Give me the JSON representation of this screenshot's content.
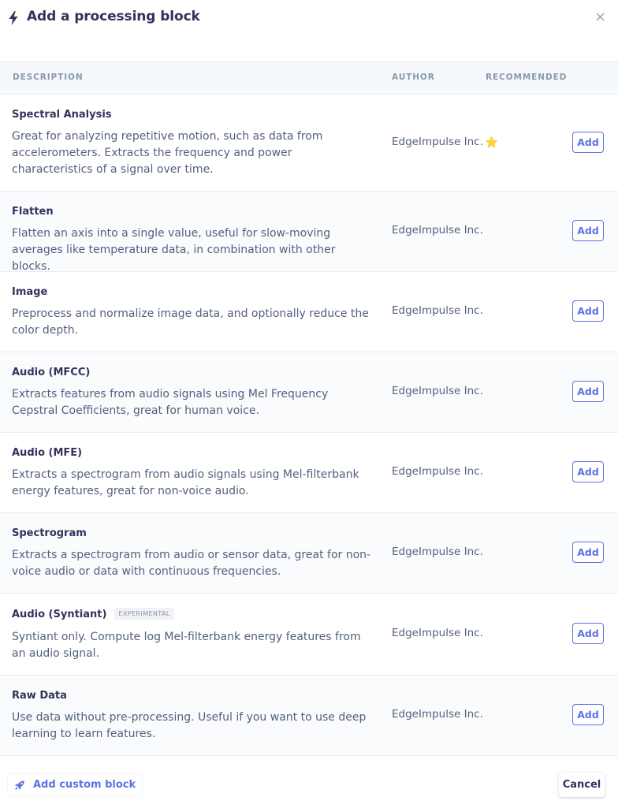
{
  "modal": {
    "title": "Add a processing block",
    "close_label": "×"
  },
  "table": {
    "headers": {
      "description": "DESCRIPTION",
      "author": "AUTHOR",
      "recommended": "RECOMMENDED"
    },
    "rows": [
      {
        "title": "Spectral Analysis",
        "description": "Great for analyzing repetitive motion, such as data from accelerometers. Extracts the frequency and power characteristics of a signal over time.",
        "author": "EdgeImpulse Inc.",
        "recommended": true,
        "add_label": "Add"
      },
      {
        "title": "Flatten",
        "description": "Flatten an axis into a single value, useful for slow-moving averages like temperature data, in combination with other blocks.",
        "author": "EdgeImpulse Inc.",
        "recommended": false,
        "add_label": "Add"
      },
      {
        "title": "Image",
        "description": "Preprocess and normalize image data, and optionally reduce the color depth.",
        "author": "EdgeImpulse Inc.",
        "recommended": false,
        "add_label": "Add"
      },
      {
        "title": "Audio (MFCC)",
        "description": "Extracts features from audio signals using Mel Frequency Cepstral Coefficients, great for human voice.",
        "author": "EdgeImpulse Inc.",
        "recommended": false,
        "add_label": "Add"
      },
      {
        "title": "Audio (MFE)",
        "description": "Extracts a spectrogram from audio signals using Mel-filterbank energy features, great for non-voice audio.",
        "author": "EdgeImpulse Inc.",
        "recommended": false,
        "add_label": "Add"
      },
      {
        "title": "Spectrogram",
        "description": "Extracts a spectrogram from audio or sensor data, great for non-voice audio or data with continuous frequencies.",
        "author": "EdgeImpulse Inc.",
        "recommended": false,
        "add_label": "Add"
      },
      {
        "title": "Audio (Syntiant)",
        "badge": "EXPERIMENTAL",
        "description": "Syntiant only. Compute log Mel-filterbank energy features from an audio signal.",
        "author": "EdgeImpulse Inc.",
        "recommended": false,
        "add_label": "Add"
      },
      {
        "title": "Raw Data",
        "description": "Use data without pre-processing. Useful if you want to use deep learning to learn features.",
        "author": "EdgeImpulse Inc.",
        "recommended": false,
        "add_label": "Add"
      }
    ]
  },
  "footer": {
    "custom_block_label": "Add custom block",
    "cancel_label": "Cancel"
  },
  "icons": {
    "header": "bolt-icon",
    "recommended": "star-icon",
    "custom_block": "rocket-icon",
    "close": "close-icon"
  },
  "colors": {
    "accent": "#5e72e4",
    "star": "#ffd43b",
    "text": "#32325d",
    "muted": "#8898aa"
  }
}
